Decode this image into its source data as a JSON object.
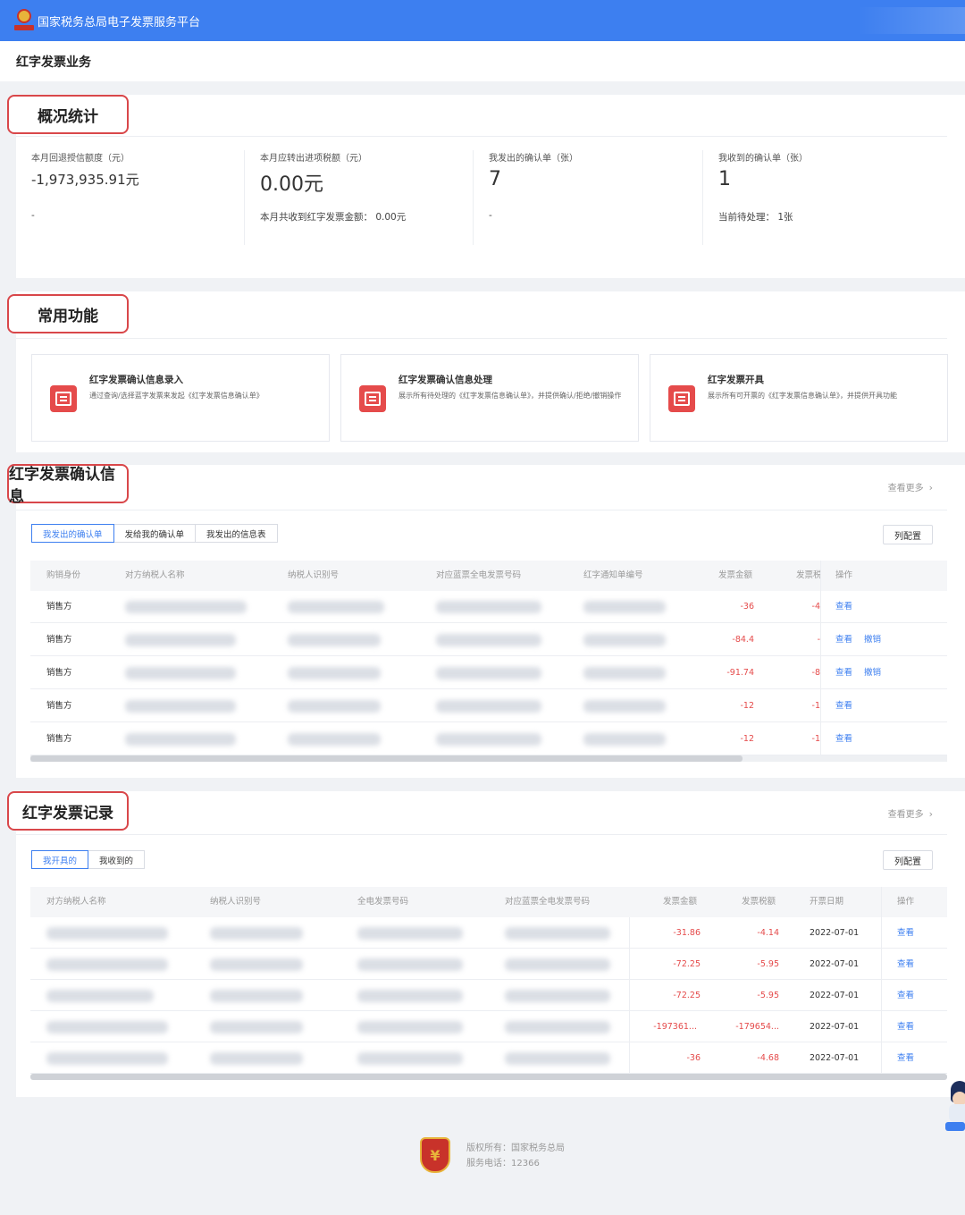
{
  "header": {
    "title": "国家税务总局电子发票服务平台"
  },
  "page": {
    "title": "红字发票业务"
  },
  "overview": {
    "title": "概况统计",
    "stats": [
      {
        "label": "本月回退授信额度（元）",
        "value": "-1,973,935.91元",
        "sub": "-"
      },
      {
        "label": "本月应转出进项税额（元）",
        "value": "0.00元",
        "sub": "本月共收到红字发票金额：  0.00元"
      },
      {
        "label": "我发出的确认单（张）",
        "value": "7",
        "sub": "-"
      },
      {
        "label": "我收到的确认单（张）",
        "value": "1",
        "sub": "当前待处理：  1张"
      }
    ]
  },
  "functions": {
    "title": "常用功能",
    "cards": [
      {
        "name": "红字发票确认信息录入",
        "desc": "通过查询/选择蓝字发票来发起《红字发票信息确认单》",
        "icon": "form-entry-icon"
      },
      {
        "name": "红字发票确认信息处理",
        "desc": "展示所有待处理的《红字发票信息确认单》，并提供确认/拒绝/撤销操作",
        "icon": "document-check-icon"
      },
      {
        "name": "红字发票开具",
        "desc": "展示所有可开票的《红字发票信息确认单》，并提供开具功能",
        "icon": "invoice-issue-icon"
      }
    ]
  },
  "confirm": {
    "title": "红字发票确认信息",
    "more": "查看更多",
    "tabs": [
      "我发出的确认单",
      "发给我的确认单",
      "我发出的信息表"
    ],
    "active_tab": 0,
    "col_config": "列配置",
    "columns": [
      "购销身份",
      "对方纳税人名称",
      "纳税人识别号",
      "对应蓝票全电发票号码",
      "红字通知单编号",
      "发票金额",
      "发票税",
      "操作"
    ],
    "rows": [
      {
        "role": "销售方",
        "amount": "-36",
        "tax": "-4",
        "actions": [
          "查看"
        ]
      },
      {
        "role": "销售方",
        "amount": "-84.4",
        "tax": "-",
        "actions": [
          "查看",
          "撤销"
        ]
      },
      {
        "role": "销售方",
        "amount": "-91.74",
        "tax": "-8",
        "actions": [
          "查看",
          "撤销"
        ]
      },
      {
        "role": "销售方",
        "amount": "-12",
        "tax": "-1",
        "actions": [
          "查看"
        ]
      },
      {
        "role": "销售方",
        "amount": "-12",
        "tax": "-1",
        "actions": [
          "查看"
        ]
      }
    ]
  },
  "records": {
    "title": "红字发票记录",
    "more": "查看更多",
    "tabs": [
      "我开具的",
      "我收到的"
    ],
    "active_tab": 0,
    "col_config": "列配置",
    "columns": [
      "对方纳税人名称",
      "纳税人识别号",
      "全电发票号码",
      "对应蓝票全电发票号码",
      "发票金额",
      "发票税额",
      "开票日期",
      "操作"
    ],
    "rows": [
      {
        "amount": "-31.86",
        "tax": "-4.14",
        "date": "2022-07-01",
        "action": "查看"
      },
      {
        "amount": "-72.25",
        "tax": "-5.95",
        "date": "2022-07-01",
        "action": "查看"
      },
      {
        "amount": "-72.25",
        "tax": "-5.95",
        "date": "2022-07-01",
        "action": "查看"
      },
      {
        "amount": "-197361...",
        "tax": "-179654...",
        "date": "2022-07-01",
        "action": "查看"
      },
      {
        "amount": "-36",
        "tax": "-4.68",
        "date": "2022-07-01",
        "action": "查看"
      }
    ]
  },
  "footer": {
    "copyright": "版权所有：国家税务总局",
    "phone": "服务电话：12366"
  }
}
